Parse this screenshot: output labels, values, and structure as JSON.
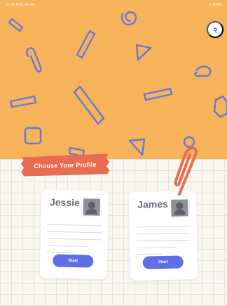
{
  "status_bar": {
    "left_text": "11:00  Mon Jul 4th",
    "right_text": "✦ 100%"
  },
  "top": {
    "background_color": "#f6b35a",
    "accent_stroke": "#6a77d7",
    "settings_icon": "gear-icon"
  },
  "tape": {
    "label": "Choose Your Profile",
    "color": "#e86c4f"
  },
  "profiles": [
    {
      "name": "Jessie",
      "start_label": "Start"
    },
    {
      "name": "James",
      "start_label": "Start"
    }
  ],
  "bottom": {
    "background_color": "#f8f6f0",
    "grid_color": "#e7e1d8"
  },
  "paperclip_color": "#e86c4f"
}
